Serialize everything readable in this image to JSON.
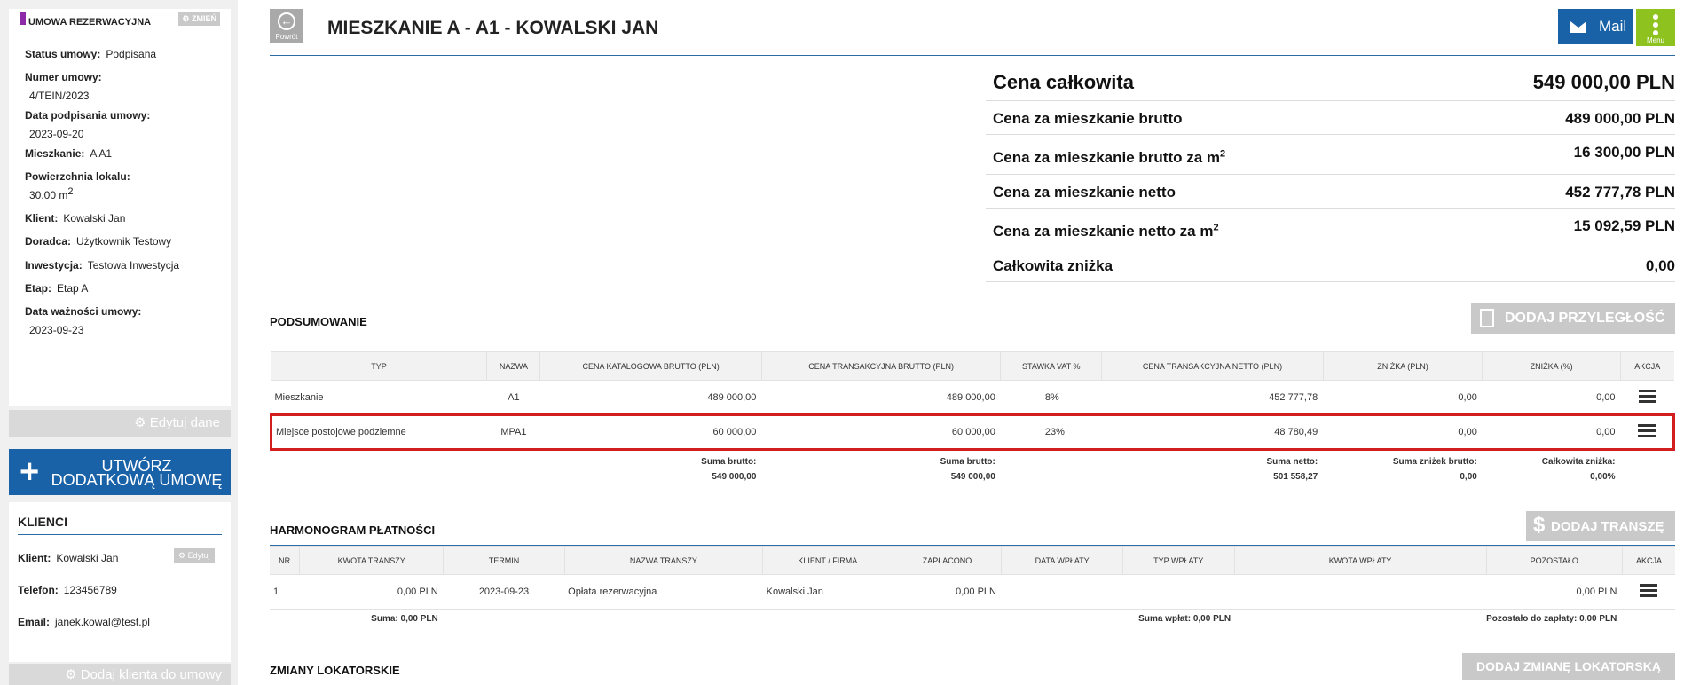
{
  "contract": {
    "section_title": "UMOWA REZERWACYJNA",
    "change_label": "ZMIEŃ",
    "status_label": "Status umowy:",
    "status_value": "Podpisana",
    "number_label": "Numer umowy:",
    "number_value": "4/TEIN/2023",
    "sign_date_label": "Data podpisania umowy:",
    "sign_date_value": "2023-09-20",
    "apartment_label": "Mieszkanie:",
    "apartment_value": "A A1",
    "area_label": "Powierzchnia lokalu:",
    "area_value": "30.00 m",
    "area_unit_sup": "2",
    "client_label": "Klient:",
    "client_value": "Kowalski Jan",
    "advisor_label": "Doradca:",
    "advisor_value": "Użytkownik Testowy",
    "investment_label": "Inwestycja:",
    "investment_value": "Testowa Inwestycja",
    "stage_label": "Etap:",
    "stage_value": "Etap A",
    "validity_label": "Data ważności umowy:",
    "validity_value": "2023-09-23",
    "edit_data_label": "Edytuj dane",
    "create_additional_label": "UTWÓRZ DODATKOWĄ UMOWĘ"
  },
  "clients": {
    "title": "KLIENCI",
    "client_label": "Klient:",
    "client_value": "Kowalski Jan",
    "edit_label": "Edytuj",
    "phone_label": "Telefon:",
    "phone_value": "123456789",
    "email_label": "Email:",
    "email_value": "janek.kowal@test.pl",
    "add_client_label": "Dodaj klienta do umowy"
  },
  "header": {
    "back_label": "Powrót",
    "title": "MIESZKANIE A - A1 - KOWALSKI JAN",
    "mail_label": "Mail",
    "menu_label": "Menu"
  },
  "prices": {
    "total_label": "Cena całkowita",
    "total_value": "549 000,00 PLN",
    "gross_label": "Cena za mieszkanie brutto",
    "gross_value": "489 000,00 PLN",
    "gross_m2_label": "Cena za mieszkanie brutto za m",
    "gross_m2_value": "16 300,00 PLN",
    "net_label": "Cena za mieszkanie netto",
    "net_value": "452 777,78 PLN",
    "net_m2_label": "Cena za mieszkanie netto za m",
    "net_m2_value": "15 092,59 PLN",
    "discount_label": "Całkowita zniżka",
    "discount_value": "0,00",
    "m2_sup": "2"
  },
  "summary": {
    "title": "PODSUMOWANIE",
    "add_adjacent_label": "DODAJ PRZYLEGŁOŚĆ",
    "headers": [
      "TYP",
      "NAZWA",
      "CENA KATALOGOWA BRUTTO (PLN)",
      "CENA TRANSAKCYJNA BRUTTO (PLN)",
      "STAWKA VAT %",
      "CENA TRANSAKCYJNA NETTO (PLN)",
      "ZNIŻKA (PLN)",
      "ZNIŻKA (%)",
      "AKCJA"
    ],
    "rows": [
      {
        "type": "Mieszkanie",
        "name": "A1",
        "catalog_gross": "489 000,00",
        "trans_gross": "489 000,00",
        "vat": "8%",
        "trans_net": "452 777,78",
        "discount_pln": "0,00",
        "discount_pct": "0,00"
      },
      {
        "type": "Miejsce postojowe podziemne",
        "name": "MPA1",
        "catalog_gross": "60 000,00",
        "trans_gross": "60 000,00",
        "vat": "23%",
        "trans_net": "48 780,49",
        "discount_pln": "0,00",
        "discount_pct": "0,00"
      }
    ],
    "sum_gross_label": "Suma brutto:",
    "sum_catalog_gross": "549 000,00",
    "sum_trans_gross": "549 000,00",
    "sum_net_label": "Suma netto:",
    "sum_net": "501 558,27",
    "sum_discounts_label": "Suma zniżek brutto:",
    "sum_discounts": "0,00",
    "total_discount_label": "Całkowita zniżka:",
    "total_discount": "0,00%"
  },
  "schedule": {
    "title": "HARMONOGRAM PŁATNOŚCI",
    "add_tranche_label": "DODAJ TRANSZĘ",
    "headers": [
      "NR",
      "KWOTA TRANSZY",
      "TERMIN",
      "NAZWA TRANSZY",
      "KLIENT / FIRMA",
      "ZAPŁACONO",
      "DATA WPŁATY",
      "TYP WPŁATY",
      "KWOTA WPŁATY",
      "POZOSTAŁO",
      "AKCJA"
    ],
    "rows": [
      {
        "nr": "1",
        "amount": "0,00 PLN",
        "term": "2023-09-23",
        "name": "Opłata rezerwacyjna",
        "client": "Kowalski Jan",
        "paid": "0,00 PLN",
        "pay_date": "",
        "pay_type": "",
        "pay_amount": "",
        "remaining": "0,00 PLN"
      }
    ],
    "sum_label": "Suma: 0,00 PLN",
    "sum_payments_label": "Suma wpłat: 0,00 PLN",
    "remaining_label": "Pozostało do zapłaty: 0,00 PLN"
  },
  "tenant_changes": {
    "title": "ZMIANY LOKATORSKIE",
    "add_label": "DODAJ ZMIANĘ LOKATORSKĄ"
  }
}
